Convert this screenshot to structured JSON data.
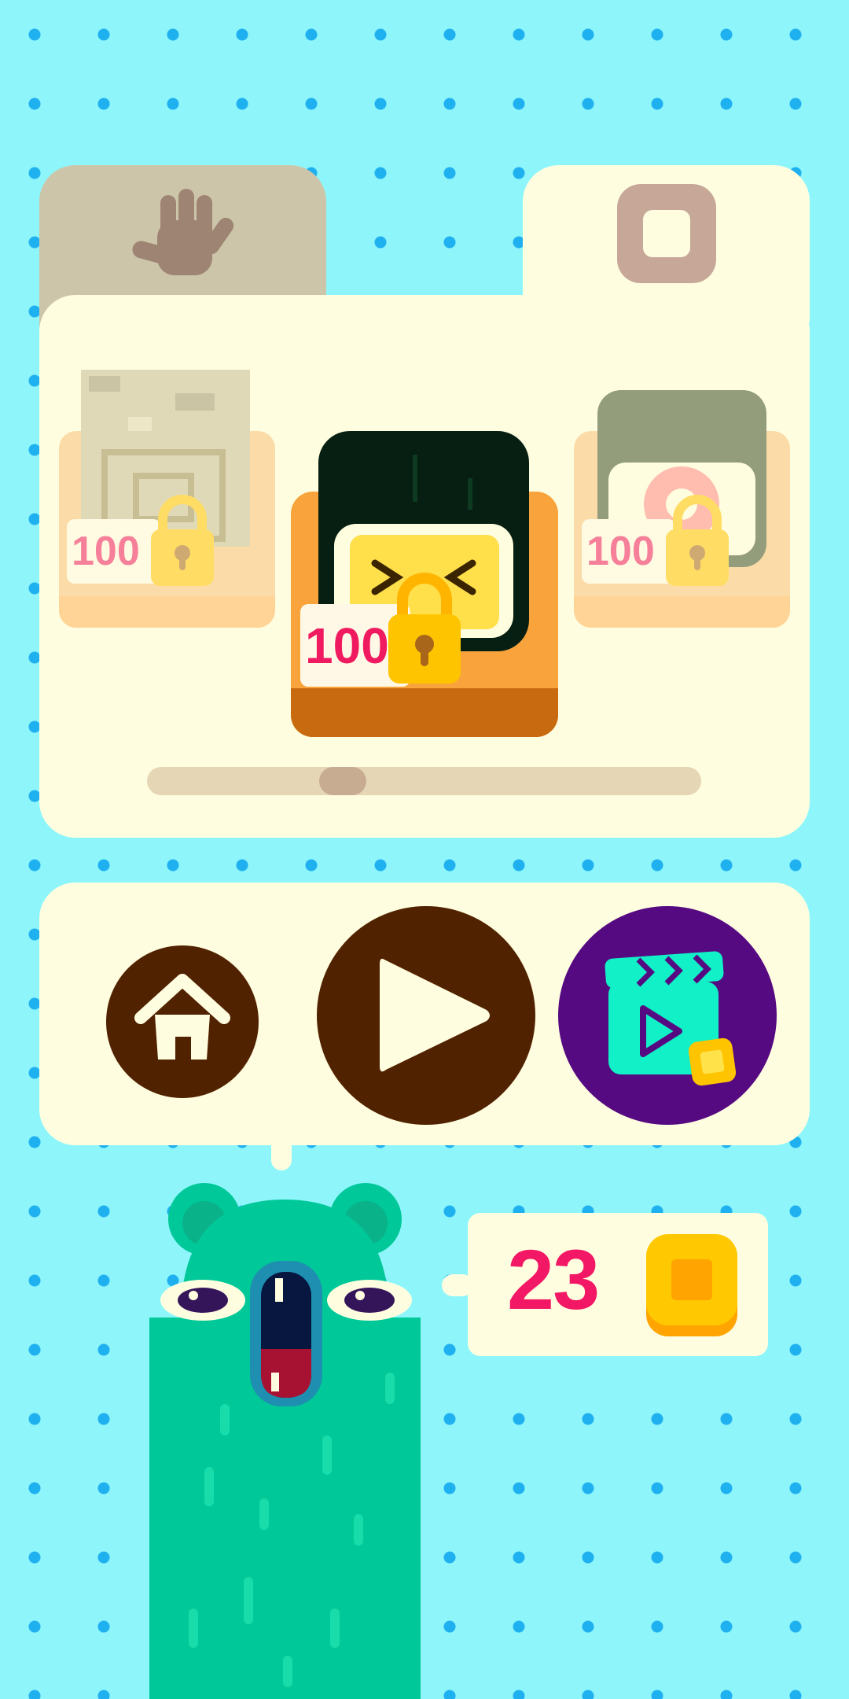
{
  "tabs": [
    {
      "name": "hands",
      "icon": "hand-icon",
      "selected": false
    },
    {
      "name": "blocks",
      "icon": "square-block-icon",
      "selected": true
    }
  ],
  "skins": [
    {
      "name": "stone",
      "price": "100",
      "locked": true,
      "selected": false
    },
    {
      "name": "sushi",
      "price": "100",
      "locked": true,
      "selected": true
    },
    {
      "name": "pink-donut",
      "price": "100",
      "locked": true,
      "selected": false
    }
  ],
  "scroll": {
    "position": 0.34
  },
  "buttons": {
    "home": "home-icon",
    "play": "play-icon",
    "video": "video-clapper-icon"
  },
  "coins": {
    "value": "23",
    "icon": "coin-icon"
  },
  "colors": {
    "background": "#8ef6fb",
    "dots": "#1fb0f0",
    "panel": "#fffddf",
    "brown": "#512200",
    "purple": "#560a82",
    "accent_pink": "#f31865",
    "mascot": "#00c898"
  }
}
